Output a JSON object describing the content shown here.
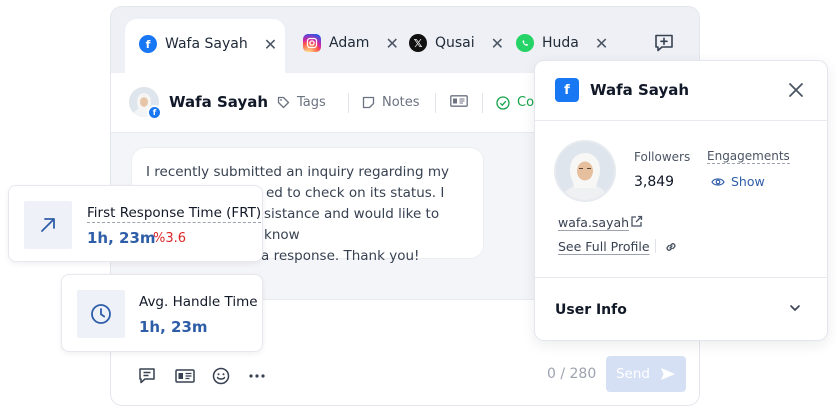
{
  "tabs": [
    {
      "label": "Wafa Sayah",
      "icon": "facebook-icon",
      "active": true
    },
    {
      "label": "Adam",
      "icon": "instagram-icon"
    },
    {
      "label": "Qusai",
      "icon": "x-icon"
    },
    {
      "label": "Huda",
      "icon": "whatsapp-icon"
    }
  ],
  "conversation": {
    "contact_name": "Wafa Sayah",
    "tags_label": "Tags",
    "notes_label": "Notes",
    "more_label": "Co",
    "message_lines": [
      "I recently submitted an inquiry regarding my",
      "ed to check on its status. I",
      "sistance and would like to know",
      "a response. Thank you!"
    ]
  },
  "composer": {
    "counter": "0 / 280",
    "send_label": "Send"
  },
  "metrics": {
    "frt": {
      "label": "First Response Time (FRT)",
      "value": "1h, 23m",
      "delta": "%3.6"
    },
    "aht": {
      "label": "Avg. Handle Time",
      "value": "1h, 23m"
    }
  },
  "profile": {
    "title": "Wafa Sayah",
    "followers_label": "Followers",
    "followers_value": "3,849",
    "engagements_label": "Engagements",
    "engagements_action": "Show",
    "username": "wafa.sayah",
    "full_profile_label": "See Full Profile",
    "user_info_label": "User Info"
  },
  "colors": {
    "facebook": "#1877f2",
    "metric_value": "#2f5ea8",
    "delta_negative": "#dc2626",
    "send_disabled": "#d5e0f4"
  }
}
